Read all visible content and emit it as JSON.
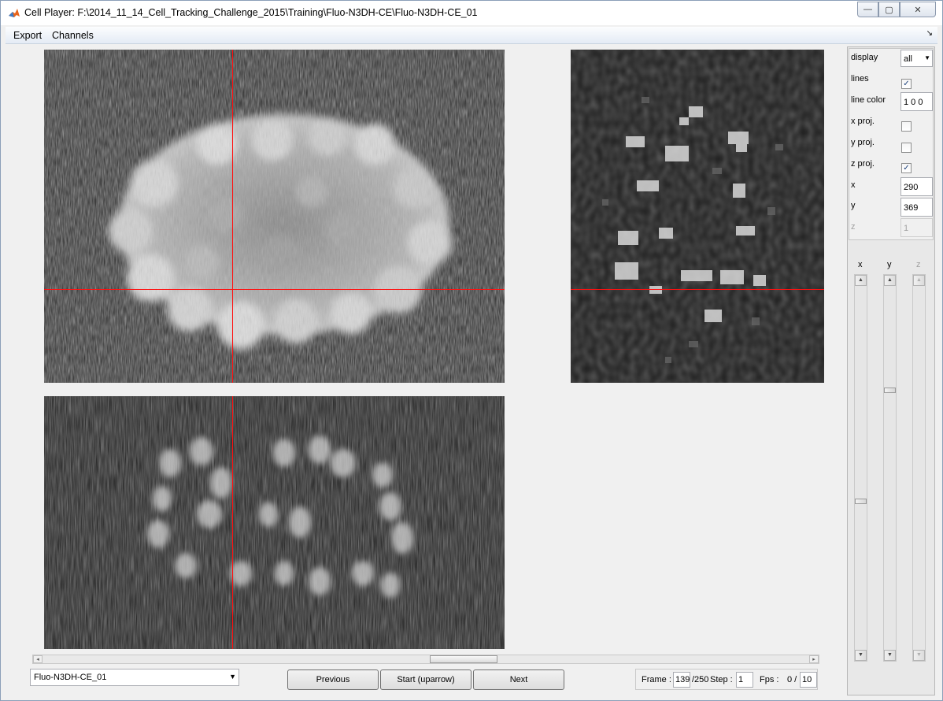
{
  "window": {
    "title": "Cell Player: F:\\2014_11_14_Cell_Tracking_Challenge_2015\\Training\\Fluo-N3DH-CE\\Fluo-N3DH-CE_01",
    "controls": {
      "minimize": "—",
      "maximize": "▢",
      "close": "✕"
    }
  },
  "menu": {
    "export": "Export",
    "channels": "Channels",
    "dock": "↘"
  },
  "views": {
    "xy_alt": "XY slice",
    "zy_alt": "ZY projection",
    "xz_alt": "XZ projection"
  },
  "controls": {
    "display_label": "display",
    "display_value": "all",
    "lines_label": "lines",
    "lines_checked": true,
    "line_color_label": "line color",
    "line_color_value": "1  0  0",
    "x_proj_label": "x proj.",
    "x_proj_checked": false,
    "y_proj_label": "y proj.",
    "y_proj_checked": false,
    "z_proj_label": "z proj.",
    "z_proj_checked": true,
    "x_label": "x",
    "x_value": "290",
    "y_label": "y",
    "y_value": "369",
    "z_label": "z",
    "z_value": "1"
  },
  "sliders": {
    "x_label": "x",
    "y_label": "y",
    "z_label": "z"
  },
  "bottom": {
    "file_select": "Fluo-N3DH-CE_01",
    "previous": "Previous",
    "start": "Start (uparrow)",
    "next": "Next",
    "frame_label": "Frame :",
    "frame_value": "139",
    "frame_total": "/250",
    "step_label": "Step :",
    "step_value": "1",
    "fps_label": "Fps :",
    "fps_current": "0 /",
    "fps_value": "10"
  },
  "colors": {
    "crosshair": "#ff1010",
    "panel_background": "#202020"
  }
}
